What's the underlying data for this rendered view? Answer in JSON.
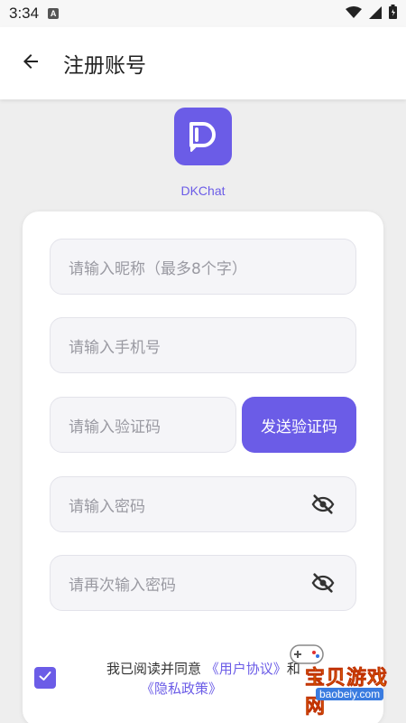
{
  "status_bar": {
    "time": "3:34",
    "notification_icon": "A"
  },
  "header": {
    "title": "注册账号",
    "back_icon": "arrow-left-icon"
  },
  "app": {
    "name": "DKChat",
    "brand_color": "#6b5ce7"
  },
  "form": {
    "nickname_placeholder": "请输入昵称（最多8个字）",
    "phone_placeholder": "请输入手机号",
    "code_placeholder": "请输入验证码",
    "send_code_label": "发送验证码",
    "password_placeholder": "请输入密码",
    "confirm_password_placeholder": "请再次输入密码"
  },
  "agreement": {
    "checked": true,
    "text_prefix": "我已阅读并同意",
    "user_agreement": "《用户协议》",
    "conjunction": "和",
    "privacy_policy": "《隐私政策》"
  },
  "watermark": {
    "title": "宝贝游戏网",
    "url": "baobeiy.com"
  }
}
